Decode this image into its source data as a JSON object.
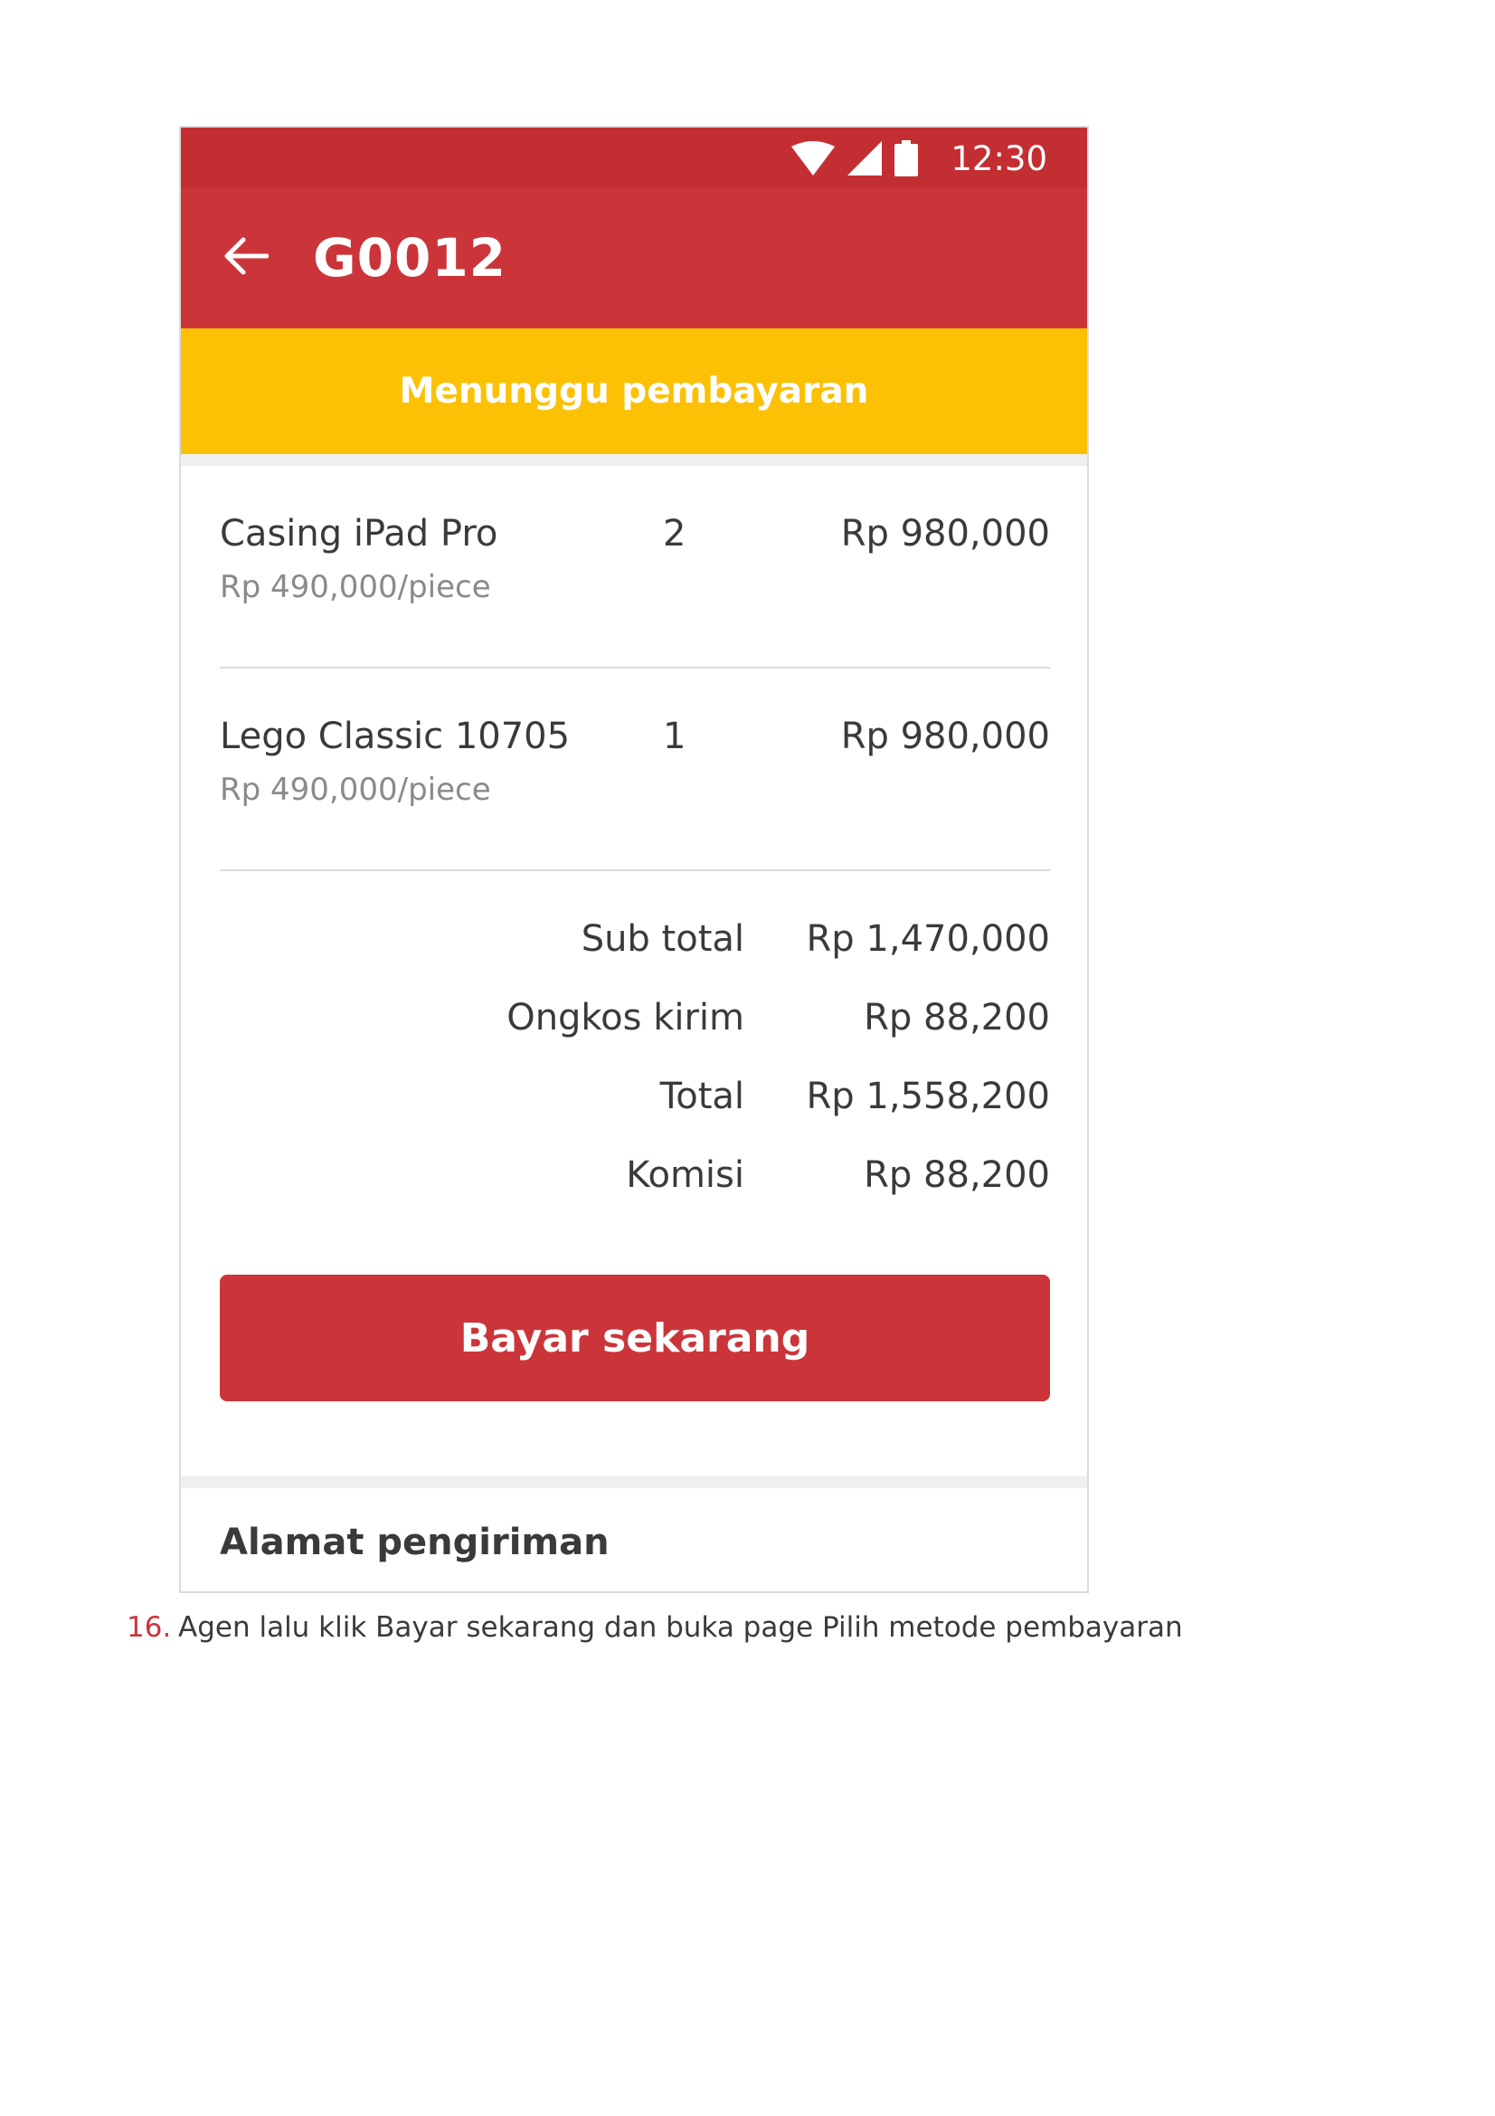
{
  "status_bar": {
    "time": "12:30",
    "icons": [
      "wifi-icon",
      "signal-icon",
      "battery-icon"
    ]
  },
  "app_bar": {
    "title": "G0012",
    "back_icon": "arrow-left-icon"
  },
  "status_banner": {
    "text": "Menunggu pembayaran",
    "color": "#fcc104"
  },
  "order_items": [
    {
      "name": "Casing iPad Pro",
      "unit_price": "Rp 490,000/piece",
      "qty": "2",
      "price": "Rp 980,000"
    },
    {
      "name": "Lego Classic 10705",
      "unit_price": "Rp 490,000/piece",
      "qty": "1",
      "price": "Rp 980,000"
    }
  ],
  "summary": [
    {
      "label": "Sub total",
      "value": "Rp 1,470,000"
    },
    {
      "label": "Ongkos kirim",
      "value": "Rp 88,200"
    },
    {
      "label": "Total",
      "value": "Rp 1,558,200"
    },
    {
      "label": "Komisi",
      "value": "Rp 88,200"
    }
  ],
  "pay_button": {
    "label": "Bayar sekarang"
  },
  "shipping_section": {
    "title": "Alamat pengiriman"
  },
  "caption": {
    "number": "16.",
    "text": "Agen lalu klik Bayar sekarang dan buka page Pilih metode pembayaran"
  },
  "colors": {
    "primary": "#cb353a",
    "status_bar": "#c32e33",
    "banner": "#fcc104"
  }
}
